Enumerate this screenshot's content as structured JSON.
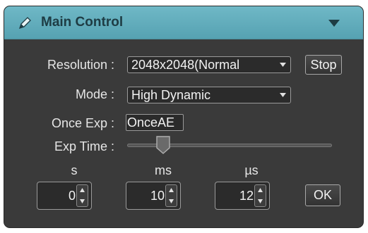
{
  "panel": {
    "title": "Main Control",
    "icons": {
      "edit": "pencil-icon",
      "collapse": "triangle-down-icon"
    },
    "colors": {
      "header": "#5faebd",
      "background": "#3a3a3a",
      "text": "#e6e6e6"
    }
  },
  "resolution": {
    "label": "Resolution :",
    "selected": "2048x2048(Normal",
    "stop_label": "Stop"
  },
  "mode": {
    "label": "Mode :",
    "selected": "High Dynamic"
  },
  "once_exp": {
    "label": "Once Exp :",
    "value": "OnceAE"
  },
  "exp_time": {
    "label": "Exp Time :",
    "slider_level": 0.15
  },
  "time_inputs": [
    {
      "unit": "s",
      "value": "0"
    },
    {
      "unit": "ms",
      "value": "10"
    },
    {
      "unit": "µs",
      "value": "12"
    }
  ],
  "ok_label": "OK"
}
